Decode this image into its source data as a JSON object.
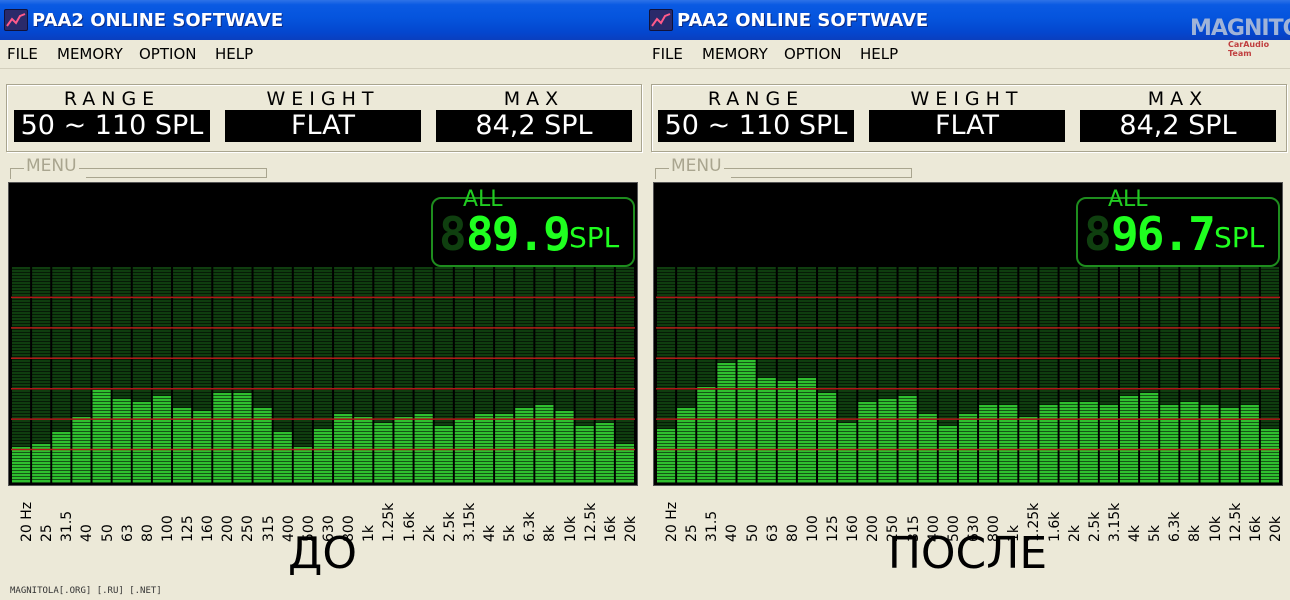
{
  "windows": [
    {
      "id": "left",
      "title": "PAA2 ONLINE SOFTWAVE",
      "menu": [
        "FILE",
        "MEMORY",
        "OPTION",
        "HELP"
      ],
      "readouts": [
        {
          "label": "RANGE",
          "value": "50 ~ 110 SPL"
        },
        {
          "label": "WEIGHT",
          "value": "FLAT"
        },
        {
          "label": "MAX",
          "value": "84,2 SPL"
        }
      ],
      "menu_group_label": "MENU",
      "spl": {
        "label": "ALL",
        "ghost": "8",
        "value": "89.9",
        "unit": "SPL"
      },
      "caption": "ДО"
    },
    {
      "id": "right",
      "title": "PAA2 ONLINE SOFTWAVE",
      "menu": [
        "FILE",
        "MEMORY",
        "OPTION",
        "HELP"
      ],
      "readouts": [
        {
          "label": "RANGE",
          "value": "50 ~ 110 SPL"
        },
        {
          "label": "WEIGHT",
          "value": "FLAT"
        },
        {
          "label": "MAX",
          "value": "84,2 SPL"
        }
      ],
      "menu_group_label": "MENU",
      "spl": {
        "label": "ALL",
        "ghost": "8",
        "value": "96.7",
        "unit": "SPL"
      },
      "caption": "ПОСЛЕ"
    }
  ],
  "logo": {
    "text": "MAGNITOLA",
    "sub": "CarAudio Team"
  },
  "footer": "MAGNITOLA[.ORG] [.RU] [.NET]",
  "colors": {
    "title_bg": "#0554dd",
    "bar_green": "#2fbf2f",
    "bar_dim": "#0f3d0f",
    "ref_line": "#b01818",
    "spl_green": "#1fff1f"
  },
  "chart_data": [
    {
      "type": "bar",
      "name": "ДО",
      "categories": [
        "20 Hz",
        "25",
        "31.5",
        "40",
        "50",
        "63",
        "80",
        "100",
        "125",
        "160",
        "200",
        "250",
        "315",
        "400",
        "500",
        "630",
        "800",
        "1k",
        "1.25k",
        "1.6k",
        "2k",
        "2.5k",
        "3.15k",
        "4k",
        "5k",
        "6.3k",
        "8k",
        "10k",
        "12.5k",
        "16k",
        "20k"
      ],
      "values": [
        12,
        13,
        17,
        22,
        31,
        28,
        27,
        29,
        25,
        24,
        30,
        30,
        25,
        17,
        12,
        18,
        23,
        22,
        20,
        22,
        23,
        19,
        21,
        23,
        23,
        25,
        26,
        24,
        19,
        20,
        13
      ],
      "ylim": [
        0,
        72
      ]
    },
    {
      "type": "bar",
      "name": "ПОСЛЕ",
      "categories": [
        "20 Hz",
        "25",
        "31.5",
        "40",
        "50",
        "63",
        "80",
        "100",
        "125",
        "160",
        "200",
        "250",
        "315",
        "400",
        "500",
        "630",
        "800",
        "1k",
        "1.25k",
        "1.6k",
        "2k",
        "2.5k",
        "3.15k",
        "4k",
        "5k",
        "6.3k",
        "8k",
        "10k",
        "12.5k",
        "16k",
        "20k"
      ],
      "values": [
        18,
        25,
        32,
        40,
        41,
        35,
        34,
        35,
        30,
        20,
        27,
        28,
        29,
        23,
        19,
        23,
        26,
        26,
        22,
        26,
        27,
        27,
        26,
        29,
        30,
        26,
        27,
        26,
        25,
        26,
        18
      ],
      "ylim": [
        0,
        72
      ]
    }
  ]
}
